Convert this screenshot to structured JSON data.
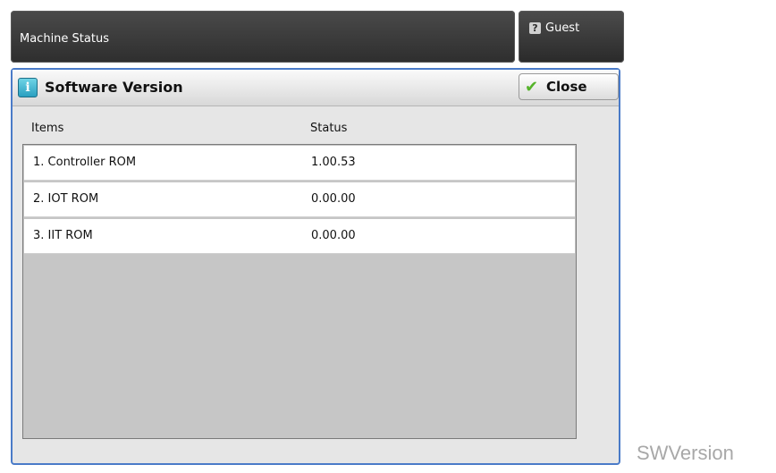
{
  "header": {
    "title": "Machine Status",
    "user_label": "Guest",
    "user_icon": "user-question-icon"
  },
  "dialog": {
    "title": "Software Version",
    "title_icon": "info-icon",
    "close_label": "Close",
    "close_icon": "check-icon",
    "accent_color": "#4a7bc8",
    "columns": [
      "Items",
      "Status"
    ],
    "rows": [
      {
        "item": "1. Controller ROM",
        "status": "1.00.53"
      },
      {
        "item": "2. IOT ROM",
        "status": "0.00.00"
      },
      {
        "item": "3. IIT ROM",
        "status": "0.00.00"
      }
    ]
  },
  "caption": "SWVersion"
}
